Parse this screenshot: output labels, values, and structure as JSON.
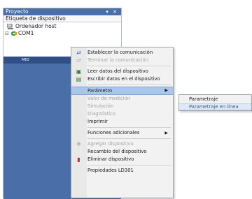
{
  "panel": {
    "title": "Proyecto",
    "controls": "▾ ✕",
    "column_header": "Etiqueta de dispositivo",
    "tree": [
      {
        "label": "Ordenador host",
        "icon": "host-computer-icon"
      },
      {
        "label": "COM1",
        "icon": "com-port-icon",
        "expander": "⊟"
      },
      {
        "label": "MID",
        "selected": true
      }
    ],
    "colors": {
      "title_bg": "#4a6fa8",
      "selection_bg": "#4a6fa8",
      "selected_row": "#2f4f86"
    }
  },
  "context_menu": {
    "items": [
      {
        "label": "Establecer la comunicación",
        "icon": "connect-icon",
        "enabled": true
      },
      {
        "label": "Terminar la comunicación",
        "icon": "disconnect-icon",
        "enabled": false
      },
      {
        "label": "Leer datos del dispositivo",
        "icon": "read-device-icon",
        "enabled": true
      },
      {
        "label": "Escribir datos en el dispositivo",
        "icon": "write-device-icon",
        "enabled": true
      },
      {
        "label": "Parámetro",
        "enabled": true,
        "submenu": true,
        "highlighted": true
      },
      {
        "label": "Valor de medición",
        "enabled": false
      },
      {
        "label": "Simulación",
        "enabled": false
      },
      {
        "label": "Diagnóstico",
        "enabled": false
      },
      {
        "label": "Imprimir",
        "enabled": true
      },
      {
        "label": "Funciones adicionales",
        "enabled": true,
        "submenu": true
      },
      {
        "label": "Agregar dispositivo",
        "icon": "add-device-icon",
        "enabled": false
      },
      {
        "label": "Recambio del dispositivo",
        "enabled": true
      },
      {
        "label": "Eliminar dispositivo",
        "icon": "delete-device-icon",
        "enabled": true
      },
      {
        "label": "Propiedades LD301",
        "enabled": true
      }
    ],
    "highlight_color": "#a9c7ea"
  },
  "submenu": {
    "items": [
      {
        "label": "Parametraje"
      },
      {
        "label": "Parametraje en línea"
      }
    ]
  }
}
